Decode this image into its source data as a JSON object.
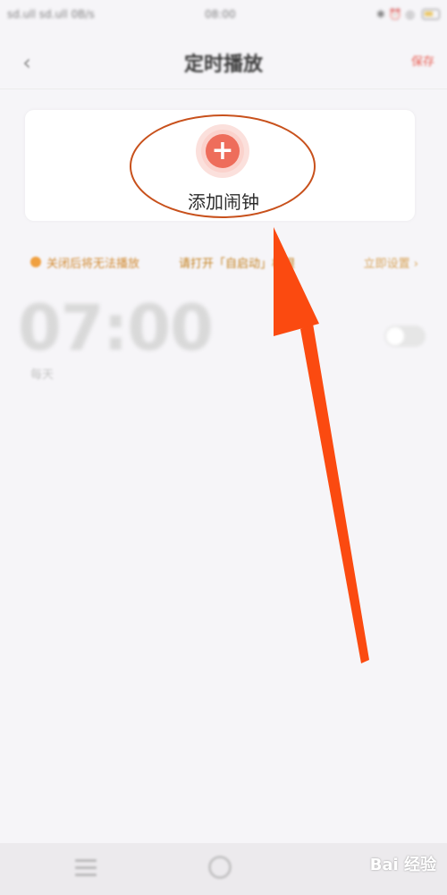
{
  "status_bar": {
    "left": "sd.ull sd.ull 0B/s",
    "time": "08:00",
    "right": "✱ ⏰ ◎"
  },
  "header": {
    "back_icon": "chevron-left-icon",
    "title": "定时播放",
    "action": "保存"
  },
  "add_alarm": {
    "icon": "plus-icon",
    "label": "添加闹钟"
  },
  "tip": {
    "left": "关闭后将无法播放",
    "middle": "请打开「自启动」权限",
    "right": "立即设置 ›"
  },
  "alarm": {
    "time": "07:00",
    "repeat": "每天",
    "enabled": false
  },
  "bottom_nav": {
    "items": [
      "menu-icon",
      "home-icon"
    ],
    "watermark": "Bai 经验"
  },
  "colors": {
    "accent": "#ee6d5b",
    "annotation": "#c8511c",
    "arrow": "#fb4a10"
  }
}
